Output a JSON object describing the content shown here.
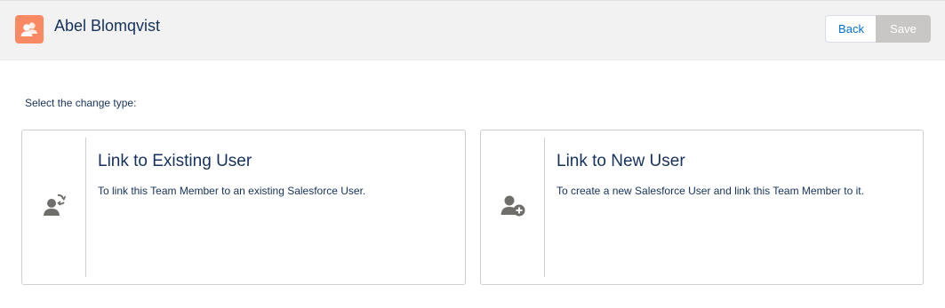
{
  "header": {
    "title": "Abel Blomqvist",
    "record_icon": "contact-icon",
    "accent_color": "#f88962",
    "back_label": "Back",
    "save_label": "Save"
  },
  "prompt": "Select the change type:",
  "options": [
    {
      "icon": "user-switch-icon",
      "title": "Link to Existing User",
      "description": "To link this Team Member to an existing Salesforce User."
    },
    {
      "icon": "user-add-icon",
      "title": "Link to New User",
      "description": "To create a new Salesforce User and link this Team Member to it."
    }
  ]
}
